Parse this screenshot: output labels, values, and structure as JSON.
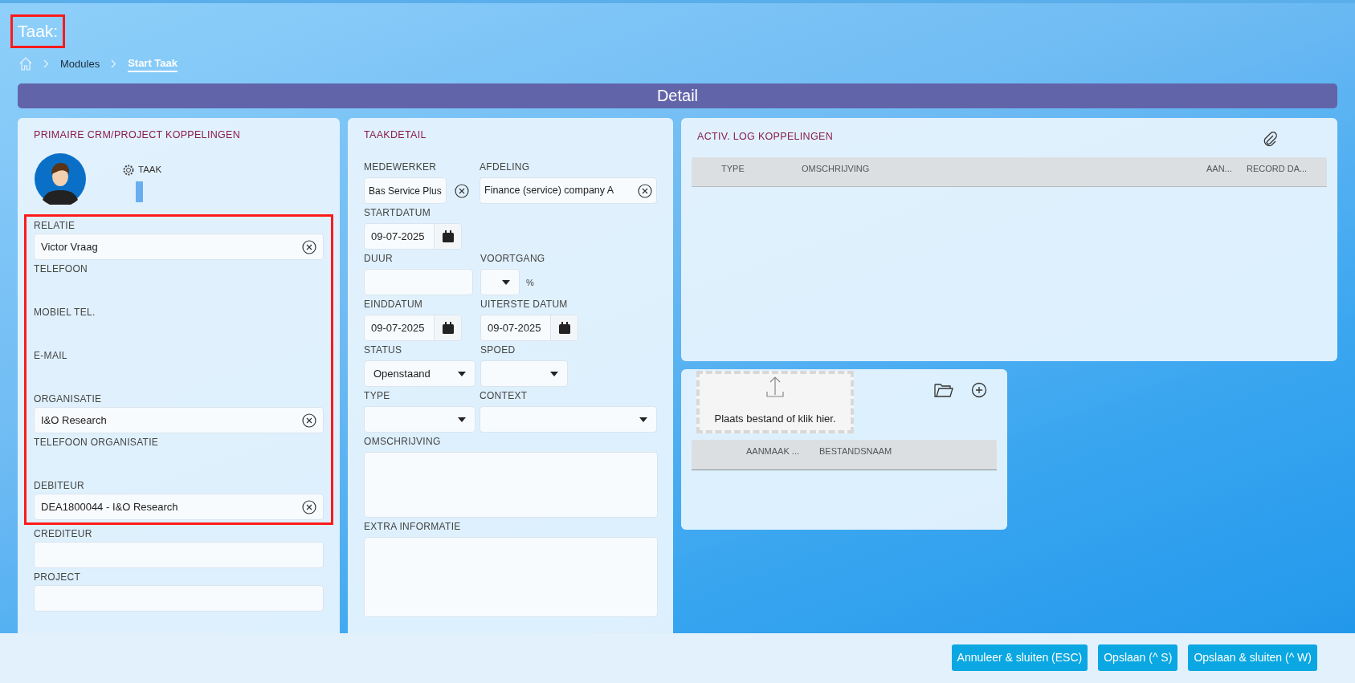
{
  "page": {
    "title": "Taak:",
    "title_highlighted": true
  },
  "breadcrumb": [
    {
      "label": "Modules",
      "selected": false
    },
    {
      "label": "Start Taak",
      "selected": true
    }
  ],
  "detail_bar": {
    "title": "Detail"
  },
  "left_panel": {
    "title": "PRIMAIRE CRM/PROJECT KOPPELINGEN",
    "tab_label": "TAAK",
    "field_groups": [
      {
        "highlighted": true,
        "fields": [
          {
            "label": "RELATIE",
            "kind": "lookup",
            "value": "Victor Vraag"
          },
          {
            "label": "TELEFOON",
            "kind": "readonly"
          },
          {
            "label": "MOBIEL TEL.",
            "kind": "readonly"
          },
          {
            "label": "E-MAIL",
            "kind": "readonly"
          },
          {
            "label": "ORGANISATIE",
            "kind": "lookup",
            "value": "I&O Research"
          },
          {
            "label": "TELEFOON ORGANISATIE",
            "kind": "readonly"
          },
          {
            "label": "DEBITEUR",
            "kind": "lookup",
            "value": "DEA1800044 - I&O Research"
          }
        ]
      },
      {
        "highlighted": false,
        "fields": [
          {
            "label": "CREDITEUR",
            "kind": "text"
          },
          {
            "label": "PROJECT",
            "kind": "text"
          }
        ]
      }
    ]
  },
  "task_panel": {
    "title": "TAAKDETAIL",
    "rows": [
      [
        {
          "label": "MEDEWERKER",
          "kind": "lookup_outside",
          "value": "Bas Service Plus"
        },
        {
          "label": "AFDELING",
          "kind": "lookup",
          "value": "Finance (service) company A"
        }
      ],
      [
        {
          "label": "STARTDATUM",
          "kind": "date",
          "value": "09-07-2025"
        }
      ],
      [
        {
          "label": "DUUR",
          "kind": "text"
        },
        {
          "label": "VOORTGANG",
          "kind": "select",
          "suffix": "%"
        }
      ],
      [
        {
          "label": "EINDDATUM",
          "kind": "date",
          "value": "09-07-2025"
        },
        {
          "label": "UITERSTE DATUM",
          "kind": "date",
          "value": "09-07-2025"
        }
      ],
      [
        {
          "label": "STATUS",
          "kind": "select",
          "value": "Openstaand"
        },
        {
          "label": "SPOED",
          "kind": "select"
        }
      ],
      [
        {
          "label": "TYPE",
          "kind": "select"
        },
        {
          "label": "CONTEXT",
          "kind": "select"
        }
      ],
      [
        {
          "label": "OMSCHRIJVING",
          "kind": "textarea"
        }
      ],
      [
        {
          "label": "EXTRA INFORMATIE",
          "kind": "textarea_tall"
        }
      ]
    ]
  },
  "activity_panel": {
    "title": "ACTIV. LOG KOPPELINGEN",
    "columns": [
      "TYPE",
      "OMSCHRIJVING",
      "AAN...",
      "RECORD DA..."
    ]
  },
  "files_panel": {
    "dropzone_text": "Plaats bestand of klik hier.",
    "columns": [
      "AANMAAK ...",
      "BESTANDSNAAM"
    ]
  },
  "footer": {
    "buttons": [
      "Annuleer & sluiten (ESC)",
      "Opslaan (^ S)",
      "Opslaan & sluiten (^ W)"
    ]
  }
}
